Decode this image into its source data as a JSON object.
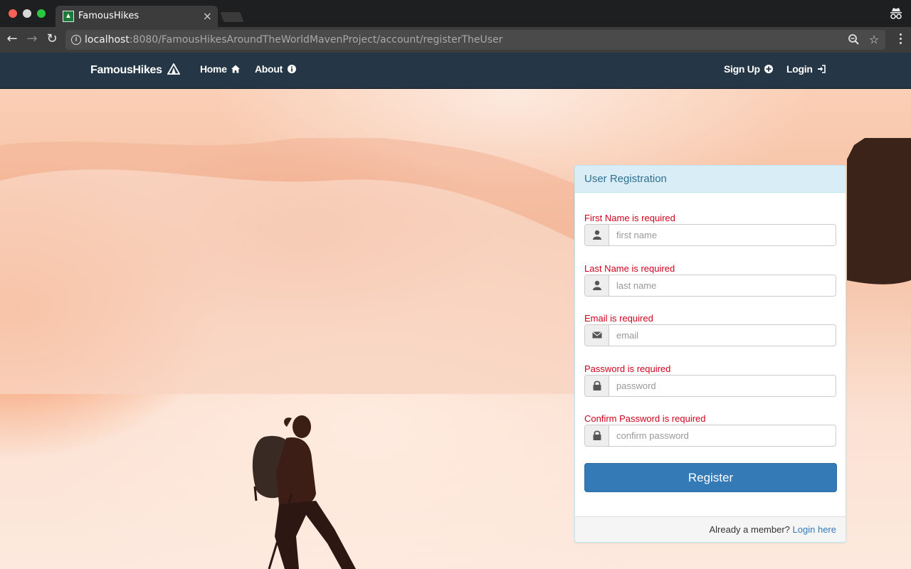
{
  "browser": {
    "tab_title": "FamousHikes",
    "url_host": "localhost",
    "url_rest": ":8080/FamousHikesAroundTheWorldMavenProject/account/registerTheUser",
    "colors": {
      "tab": "#3c3c3c",
      "toolbar": "#3c3c3c",
      "omnibox": "#4a4a4a"
    }
  },
  "nav": {
    "brand": "FamousHikes",
    "home": "Home",
    "about": "About",
    "signup": "Sign Up",
    "login": "Login",
    "background": "#253747"
  },
  "form": {
    "title": "User Registration",
    "fields": [
      {
        "error": "First Name is required",
        "placeholder": "first name",
        "icon": "user-icon"
      },
      {
        "error": "Last Name is required",
        "placeholder": "last name",
        "icon": "user-icon"
      },
      {
        "error": "Email is required",
        "placeholder": "email",
        "icon": "envelope-icon"
      },
      {
        "error": "Password is required",
        "placeholder": "password",
        "icon": "lock-icon"
      },
      {
        "error": "Confirm Password is required",
        "placeholder": "confirm password",
        "icon": "lock-icon"
      }
    ],
    "register_label": "Register",
    "footer_text": "Already a member?",
    "footer_link": "Login here",
    "colors": {
      "error": "#d0021b",
      "button": "#337ab7",
      "heading_bg": "#d9edf7",
      "heading_text": "#31708f"
    }
  }
}
